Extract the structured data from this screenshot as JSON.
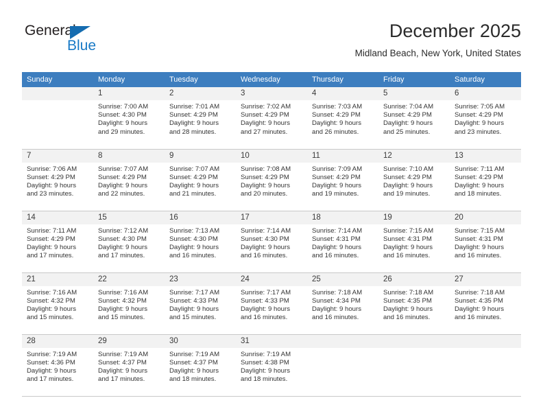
{
  "brand": {
    "name_top": "General",
    "name_bottom": "Blue",
    "triangle_color": "#156cb0",
    "blue_text_color": "#1879c6"
  },
  "header": {
    "title": "December 2025",
    "subtitle": "Midland Beach, New York, United States"
  },
  "theme": {
    "header_row_bg": "#3d7ebf",
    "daynum_bg": "#f2f2f2",
    "grid_line": "#c8c8c8",
    "text": "#333333"
  },
  "weekday_headers": [
    "Sunday",
    "Monday",
    "Tuesday",
    "Wednesday",
    "Thursday",
    "Friday",
    "Saturday"
  ],
  "weeks": [
    [
      {
        "day": "",
        "lines": []
      },
      {
        "day": "1",
        "lines": [
          "Sunrise: 7:00 AM",
          "Sunset: 4:30 PM",
          "Daylight: 9 hours",
          "and 29 minutes."
        ]
      },
      {
        "day": "2",
        "lines": [
          "Sunrise: 7:01 AM",
          "Sunset: 4:29 PM",
          "Daylight: 9 hours",
          "and 28 minutes."
        ]
      },
      {
        "day": "3",
        "lines": [
          "Sunrise: 7:02 AM",
          "Sunset: 4:29 PM",
          "Daylight: 9 hours",
          "and 27 minutes."
        ]
      },
      {
        "day": "4",
        "lines": [
          "Sunrise: 7:03 AM",
          "Sunset: 4:29 PM",
          "Daylight: 9 hours",
          "and 26 minutes."
        ]
      },
      {
        "day": "5",
        "lines": [
          "Sunrise: 7:04 AM",
          "Sunset: 4:29 PM",
          "Daylight: 9 hours",
          "and 25 minutes."
        ]
      },
      {
        "day": "6",
        "lines": [
          "Sunrise: 7:05 AM",
          "Sunset: 4:29 PM",
          "Daylight: 9 hours",
          "and 23 minutes."
        ]
      }
    ],
    [
      {
        "day": "7",
        "lines": [
          "Sunrise: 7:06 AM",
          "Sunset: 4:29 PM",
          "Daylight: 9 hours",
          "and 23 minutes."
        ]
      },
      {
        "day": "8",
        "lines": [
          "Sunrise: 7:07 AM",
          "Sunset: 4:29 PM",
          "Daylight: 9 hours",
          "and 22 minutes."
        ]
      },
      {
        "day": "9",
        "lines": [
          "Sunrise: 7:07 AM",
          "Sunset: 4:29 PM",
          "Daylight: 9 hours",
          "and 21 minutes."
        ]
      },
      {
        "day": "10",
        "lines": [
          "Sunrise: 7:08 AM",
          "Sunset: 4:29 PM",
          "Daylight: 9 hours",
          "and 20 minutes."
        ]
      },
      {
        "day": "11",
        "lines": [
          "Sunrise: 7:09 AM",
          "Sunset: 4:29 PM",
          "Daylight: 9 hours",
          "and 19 minutes."
        ]
      },
      {
        "day": "12",
        "lines": [
          "Sunrise: 7:10 AM",
          "Sunset: 4:29 PM",
          "Daylight: 9 hours",
          "and 19 minutes."
        ]
      },
      {
        "day": "13",
        "lines": [
          "Sunrise: 7:11 AM",
          "Sunset: 4:29 PM",
          "Daylight: 9 hours",
          "and 18 minutes."
        ]
      }
    ],
    [
      {
        "day": "14",
        "lines": [
          "Sunrise: 7:11 AM",
          "Sunset: 4:29 PM",
          "Daylight: 9 hours",
          "and 17 minutes."
        ]
      },
      {
        "day": "15",
        "lines": [
          "Sunrise: 7:12 AM",
          "Sunset: 4:30 PM",
          "Daylight: 9 hours",
          "and 17 minutes."
        ]
      },
      {
        "day": "16",
        "lines": [
          "Sunrise: 7:13 AM",
          "Sunset: 4:30 PM",
          "Daylight: 9 hours",
          "and 16 minutes."
        ]
      },
      {
        "day": "17",
        "lines": [
          "Sunrise: 7:14 AM",
          "Sunset: 4:30 PM",
          "Daylight: 9 hours",
          "and 16 minutes."
        ]
      },
      {
        "day": "18",
        "lines": [
          "Sunrise: 7:14 AM",
          "Sunset: 4:31 PM",
          "Daylight: 9 hours",
          "and 16 minutes."
        ]
      },
      {
        "day": "19",
        "lines": [
          "Sunrise: 7:15 AM",
          "Sunset: 4:31 PM",
          "Daylight: 9 hours",
          "and 16 minutes."
        ]
      },
      {
        "day": "20",
        "lines": [
          "Sunrise: 7:15 AM",
          "Sunset: 4:31 PM",
          "Daylight: 9 hours",
          "and 16 minutes."
        ]
      }
    ],
    [
      {
        "day": "21",
        "lines": [
          "Sunrise: 7:16 AM",
          "Sunset: 4:32 PM",
          "Daylight: 9 hours",
          "and 15 minutes."
        ]
      },
      {
        "day": "22",
        "lines": [
          "Sunrise: 7:16 AM",
          "Sunset: 4:32 PM",
          "Daylight: 9 hours",
          "and 15 minutes."
        ]
      },
      {
        "day": "23",
        "lines": [
          "Sunrise: 7:17 AM",
          "Sunset: 4:33 PM",
          "Daylight: 9 hours",
          "and 15 minutes."
        ]
      },
      {
        "day": "24",
        "lines": [
          "Sunrise: 7:17 AM",
          "Sunset: 4:33 PM",
          "Daylight: 9 hours",
          "and 16 minutes."
        ]
      },
      {
        "day": "25",
        "lines": [
          "Sunrise: 7:18 AM",
          "Sunset: 4:34 PM",
          "Daylight: 9 hours",
          "and 16 minutes."
        ]
      },
      {
        "day": "26",
        "lines": [
          "Sunrise: 7:18 AM",
          "Sunset: 4:35 PM",
          "Daylight: 9 hours",
          "and 16 minutes."
        ]
      },
      {
        "day": "27",
        "lines": [
          "Sunrise: 7:18 AM",
          "Sunset: 4:35 PM",
          "Daylight: 9 hours",
          "and 16 minutes."
        ]
      }
    ],
    [
      {
        "day": "28",
        "lines": [
          "Sunrise: 7:19 AM",
          "Sunset: 4:36 PM",
          "Daylight: 9 hours",
          "and 17 minutes."
        ]
      },
      {
        "day": "29",
        "lines": [
          "Sunrise: 7:19 AM",
          "Sunset: 4:37 PM",
          "Daylight: 9 hours",
          "and 17 minutes."
        ]
      },
      {
        "day": "30",
        "lines": [
          "Sunrise: 7:19 AM",
          "Sunset: 4:37 PM",
          "Daylight: 9 hours",
          "and 18 minutes."
        ]
      },
      {
        "day": "31",
        "lines": [
          "Sunrise: 7:19 AM",
          "Sunset: 4:38 PM",
          "Daylight: 9 hours",
          "and 18 minutes."
        ]
      },
      {
        "day": "",
        "lines": []
      },
      {
        "day": "",
        "lines": []
      },
      {
        "day": "",
        "lines": []
      }
    ]
  ]
}
